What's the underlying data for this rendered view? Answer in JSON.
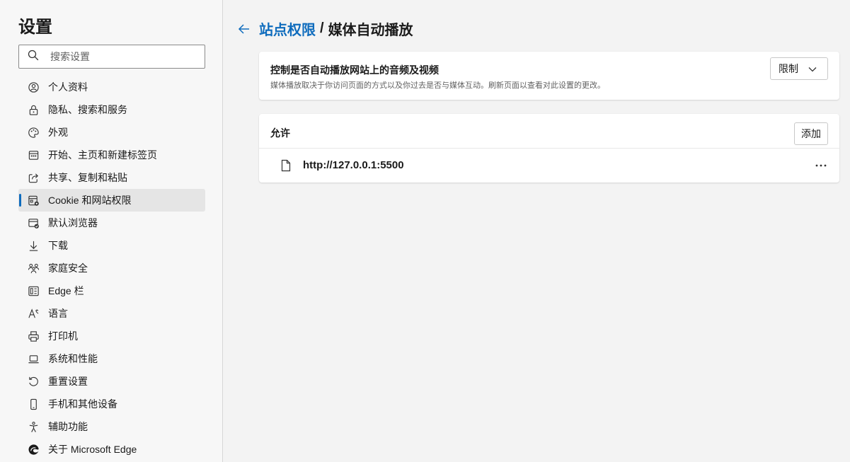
{
  "sidebar": {
    "title": "设置",
    "search": {
      "placeholder": "搜索设置",
      "value": ""
    },
    "items": [
      {
        "label": "个人资料",
        "icon": "profile-icon"
      },
      {
        "label": "隐私、搜索和服务",
        "icon": "lock-icon"
      },
      {
        "label": "外观",
        "icon": "palette-icon"
      },
      {
        "label": "开始、主页和新建标签页",
        "icon": "home-tab-icon"
      },
      {
        "label": "共享、复制和粘贴",
        "icon": "share-icon"
      },
      {
        "label": "Cookie 和网站权限",
        "icon": "cookie-site-icon",
        "active": true
      },
      {
        "label": "默认浏览器",
        "icon": "default-browser-icon"
      },
      {
        "label": "下载",
        "icon": "download-icon"
      },
      {
        "label": "家庭安全",
        "icon": "family-icon"
      },
      {
        "label": "Edge 栏",
        "icon": "edge-bar-icon"
      },
      {
        "label": "语言",
        "icon": "language-icon"
      },
      {
        "label": "打印机",
        "icon": "printer-icon"
      },
      {
        "label": "系统和性能",
        "icon": "laptop-icon"
      },
      {
        "label": "重置设置",
        "icon": "reset-icon"
      },
      {
        "label": "手机和其他设备",
        "icon": "phone-icon"
      },
      {
        "label": "辅助功能",
        "icon": "accessibility-icon"
      },
      {
        "label": "关于 Microsoft Edge",
        "icon": "edge-logo-icon"
      }
    ]
  },
  "header": {
    "breadcrumb_link": "站点权限",
    "separator": "/",
    "current": "媒体自动播放"
  },
  "autoplay": {
    "title": "控制是否自动播放网站上的音频及视频",
    "description": "媒体播放取决于你访问页面的方式以及你过去是否与媒体互动。刷新页面以查看对此设置的更改。",
    "select_value": "限制"
  },
  "allow": {
    "title": "允许",
    "add_label": "添加",
    "sites": [
      {
        "url": "http://127.0.0.1:5500"
      }
    ]
  },
  "colors": {
    "accent": "#0f6cbd",
    "sidebar_bg": "#f7f7f7",
    "page_bg": "#f3f3f3"
  }
}
